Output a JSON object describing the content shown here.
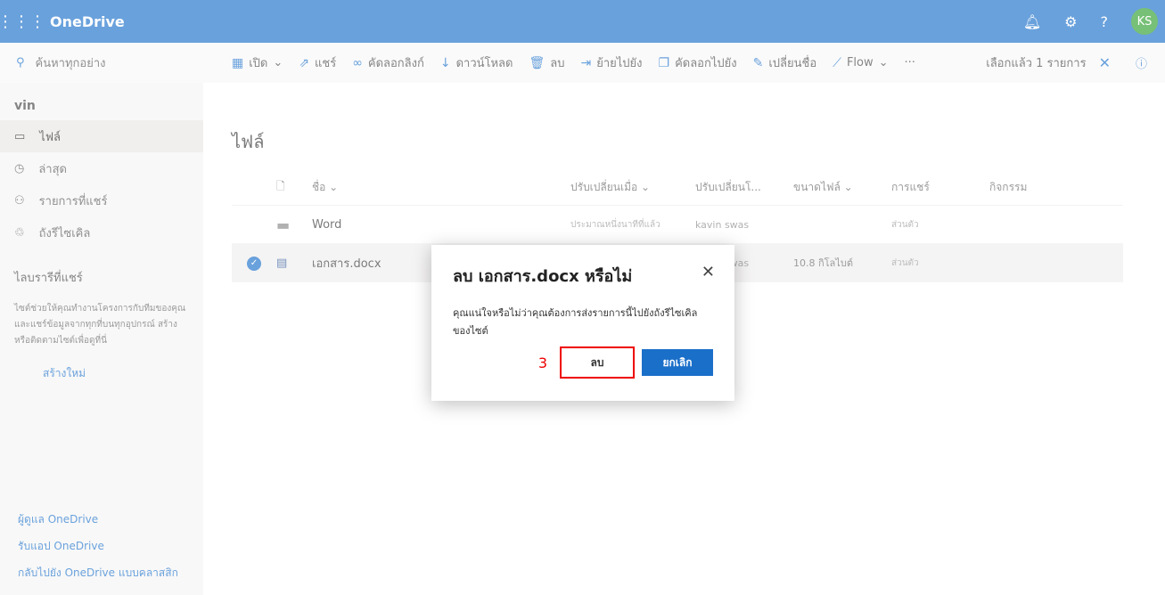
{
  "app": {
    "title": "OneDrive",
    "avatar": "KS",
    "icons": [
      "waffle-icon",
      "bell-icon",
      "gear-icon",
      "help-icon"
    ]
  },
  "search": {
    "placeholder": "ค้นหาทุกอย่าง"
  },
  "commands": [
    {
      "label": "เปิด",
      "icon": "word-icon",
      "dropdown": true
    },
    {
      "label": "แชร์",
      "icon": "share-icon"
    },
    {
      "label": "คัดลอกลิงก์",
      "icon": "link-icon"
    },
    {
      "label": "ดาวน์โหลด",
      "icon": "download-icon"
    },
    {
      "label": "ลบ",
      "icon": "trash-icon"
    },
    {
      "label": "ย้ายไปยัง",
      "icon": "move-icon"
    },
    {
      "label": "คัดลอกไปยัง",
      "icon": "copy-icon"
    },
    {
      "label": "เปลี่ยนชื่อ",
      "icon": "pencil-icon"
    },
    {
      "label": "Flow",
      "icon": "flow-icon",
      "dropdown": true
    }
  ],
  "selection": {
    "label": "เลือกแล้ว 1 รายการ"
  },
  "sidebar": {
    "user": "vin",
    "items": [
      {
        "label": "ไฟล์"
      },
      {
        "label": "ล่าสุด"
      },
      {
        "label": "รายการที่แชร์"
      },
      {
        "label": "ถังรีไซเคิล"
      }
    ],
    "library_title": "ไลบรารีที่แชร์",
    "library_desc": "ไซต์ช่วยให้คุณทำงานโครงการกับทีมของคุณ และแชร์ข้อมูลจากทุกที่บนทุกอุปกรณ์ สร้างหรือติดตามไซต์เพื่อดูที่นี่",
    "create_new": "สร้างใหม่",
    "bottom_links": [
      "ผู้ดูแล OneDrive",
      "รับแอป OneDrive",
      "กลับไปยัง OneDrive แบบคลาสสิก"
    ]
  },
  "main": {
    "title": "ไฟล์",
    "columns": [
      "ชื่อ",
      "ปรับเปลี่ยนเมื่อ",
      "ปรับเปลี่ยนโ...",
      "ขนาดไฟล์",
      "การแชร์",
      "กิจกรรม"
    ],
    "rows": [
      {
        "name": "Word",
        "modified": "ประมาณหนึ่งนาทีที่แล้ว",
        "modified_by": "kavin swas",
        "size": "",
        "sharing": "ส่วนตัว",
        "type": "folder",
        "selected": false
      },
      {
        "name": "เอกสาร.docx",
        "modified": "",
        "modified_by": "kavin swas",
        "size": "10.8 กิโลไบต์",
        "sharing": "ส่วนตัว",
        "type": "word",
        "selected": true
      }
    ]
  },
  "dialog": {
    "title": "ลบ เอกสาร.docx หรือไม่",
    "message": "คุณแน่ใจหรือไม่ว่าคุณต้องการส่งรายการนี้ไปยังถังรีไซเคิลของไซต์",
    "delete": "ลบ",
    "cancel": "ยกเลิก",
    "step": "3"
  }
}
